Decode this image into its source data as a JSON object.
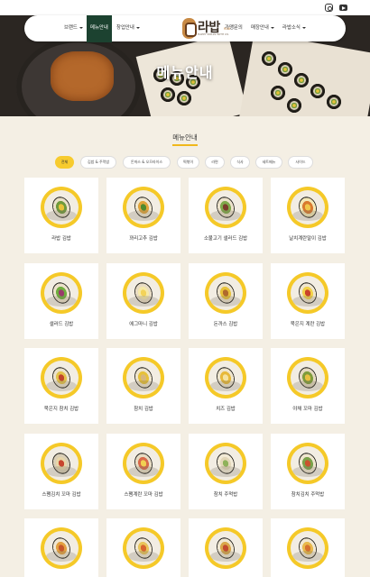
{
  "top_bar": {
    "social_icons": [
      "instagram-icon",
      "youtube-icon"
    ]
  },
  "nav": {
    "items": [
      {
        "label": "브랜드",
        "dropdown": true
      },
      {
        "label": "메뉴안내",
        "dropdown": false,
        "active": true
      },
      {
        "label": "창업안내",
        "dropdown": true
      },
      {
        "label": "가맹문의",
        "dropdown": false
      },
      {
        "label": "매장안내",
        "dropdown": true
      },
      {
        "label": "라밥소식",
        "dropdown": true
      }
    ],
    "logo": {
      "name": "라밥",
      "tag": "RAB",
      "subtitle": "HAPPY ROLLS WITH US"
    }
  },
  "hero": {
    "title": "메뉴안내"
  },
  "section": {
    "title": "메뉴안내"
  },
  "filters": [
    {
      "label": "전체",
      "active": true
    },
    {
      "label": "김밥 & 주먹밥"
    },
    {
      "label": "돈까스 & 오므라이스"
    },
    {
      "label": "떡볶이"
    },
    {
      "label": "라면"
    },
    {
      "label": "식사"
    },
    {
      "label": "세트메뉴"
    },
    {
      "label": "사이드"
    }
  ],
  "menu_items": [
    {
      "name": "라밥 김밥"
    },
    {
      "name": "꽈리고추 김밥"
    },
    {
      "name": "소불고기 샐러드 김밥"
    },
    {
      "name": "날치계란말이 김밥"
    },
    {
      "name": "샐러드 김밥"
    },
    {
      "name": "에그마니 김밥"
    },
    {
      "name": "돈까스 김밥"
    },
    {
      "name": "묵은지 계란 김밥"
    },
    {
      "name": "묵은지 참치 김밥"
    },
    {
      "name": "참치 김밥"
    },
    {
      "name": "치즈 김밥"
    },
    {
      "name": "야채 꼬마 김밥"
    },
    {
      "name": "스팸김치 꼬마 김밥"
    },
    {
      "name": "스팸계란 꼬마 김밥"
    },
    {
      "name": "참치 주먹밥"
    },
    {
      "name": "참치김치 주먹밥"
    },
    {
      "name": ""
    },
    {
      "name": ""
    },
    {
      "name": ""
    },
    {
      "name": ""
    }
  ],
  "colors": {
    "accent_yellow": "#f7cb2e",
    "nav_active": "#1c4230",
    "page_bg": "#f4efe4"
  }
}
